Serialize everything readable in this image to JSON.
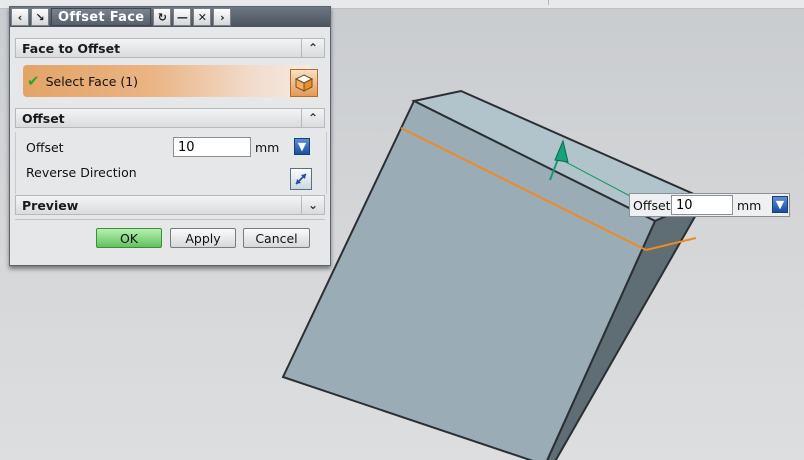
{
  "dialog": {
    "title": "Offset Face",
    "titlebar_buttons": [
      "chevron-left-icon",
      "pin-icon",
      "reset-icon",
      "minimize-icon",
      "close-icon",
      "chevron-right-icon"
    ]
  },
  "face_to_offset": {
    "header": "Face to Offset",
    "select_face_label": "Select Face (1)"
  },
  "offset_section": {
    "header": "Offset",
    "offset_label": "Offset",
    "offset_value": "10",
    "unit": "mm",
    "reverse_direction_label": "Reverse Direction"
  },
  "preview_section": {
    "header": "Preview"
  },
  "buttons": {
    "ok": "OK",
    "apply": "Apply",
    "cancel": "Cancel"
  },
  "onscreen_input": {
    "label": "Offset",
    "value": "10",
    "unit": "mm"
  },
  "colors": {
    "accent_orange": "#e8a060",
    "edge_highlight": "#f08a20",
    "handle_green": "#1a9a6a",
    "model_face": "#9aadb6",
    "model_side": "#5d6b72"
  }
}
